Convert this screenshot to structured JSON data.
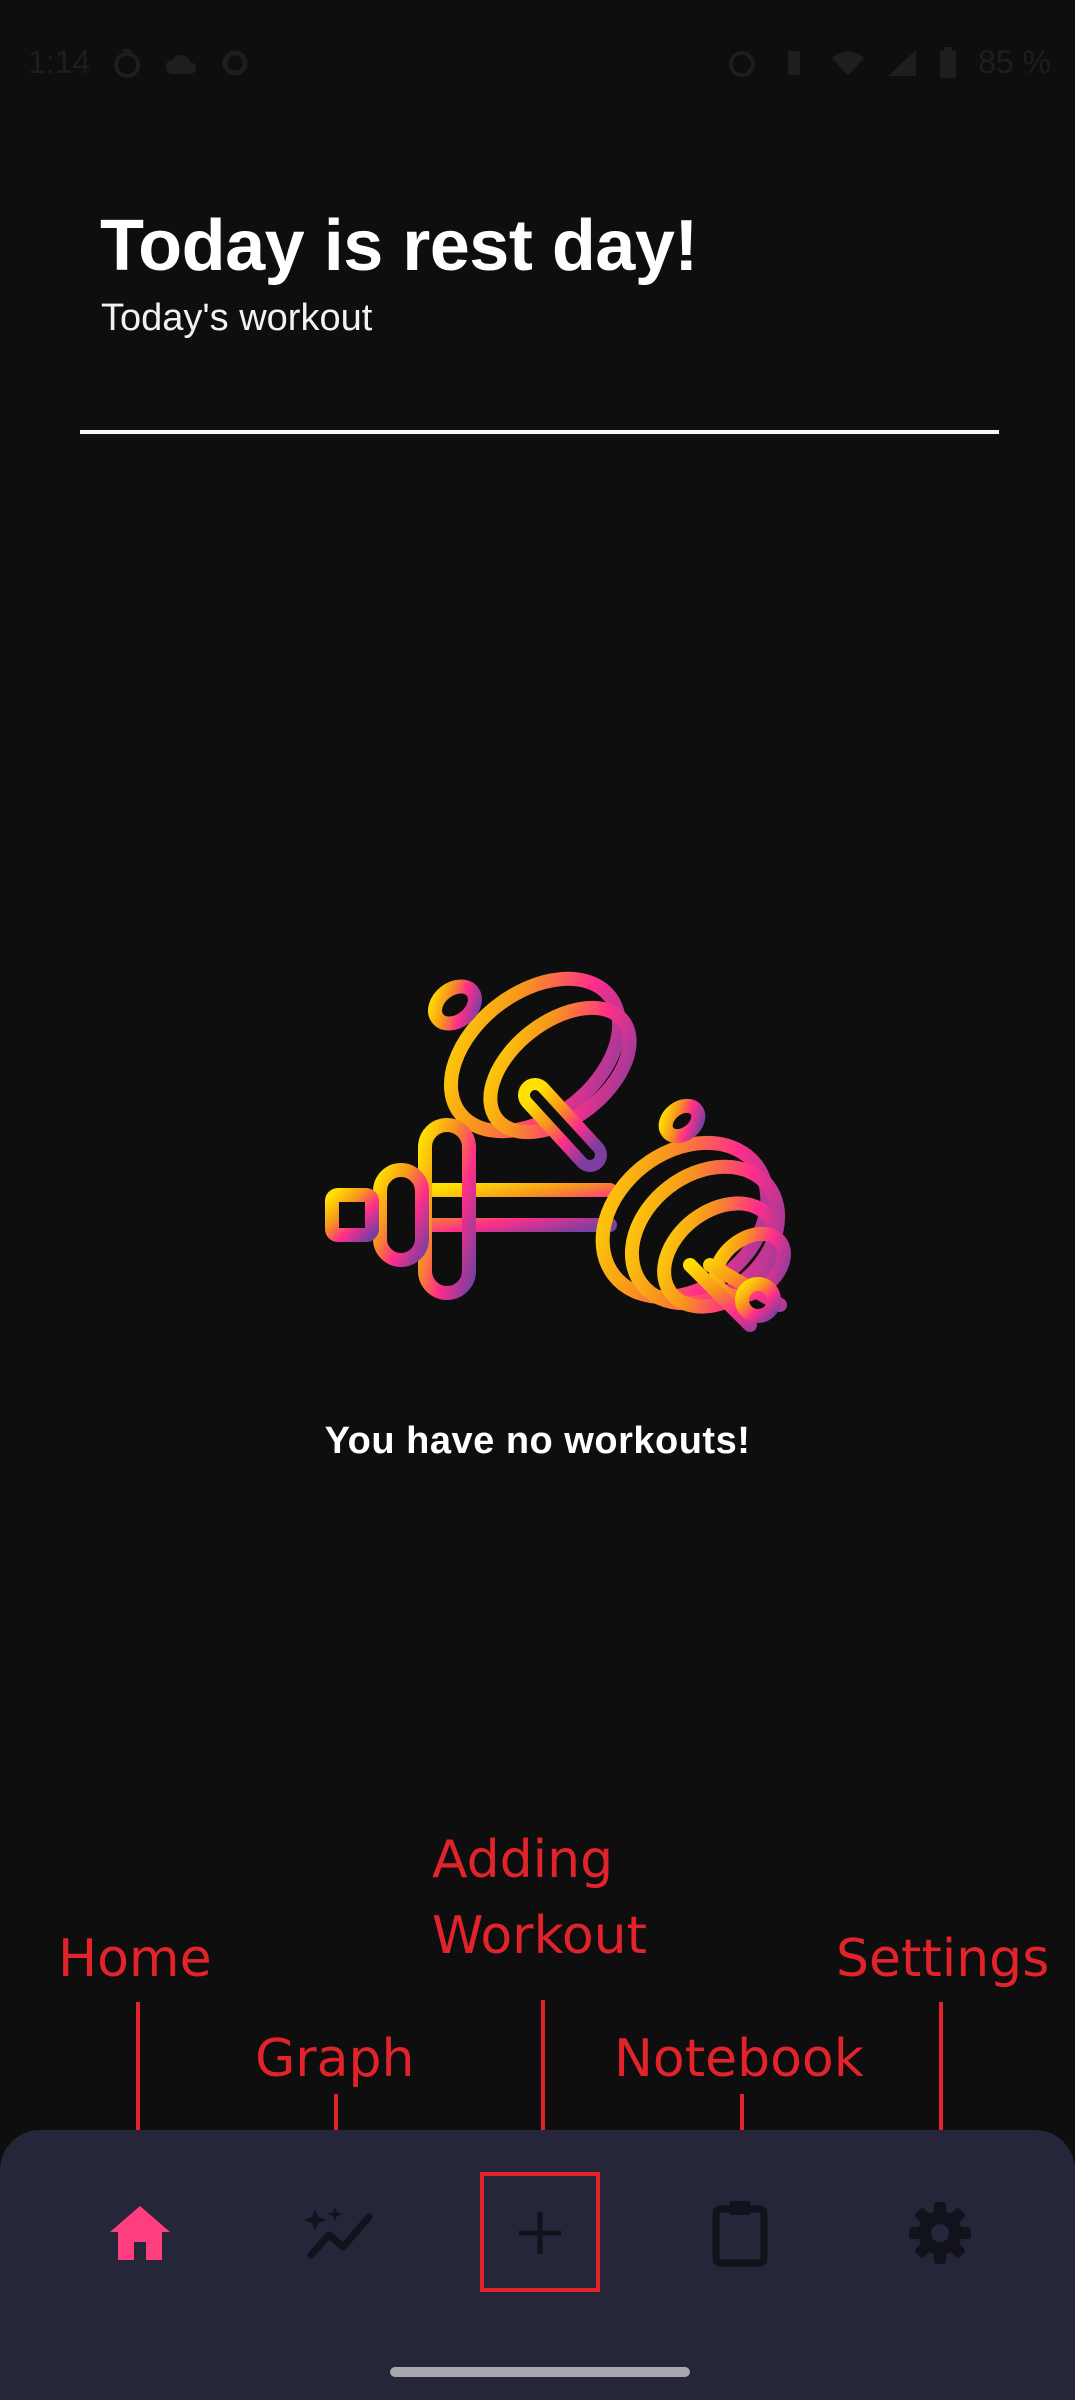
{
  "status_bar": {
    "time": "1:14",
    "battery": "85 %",
    "icons": [
      "timer-icon",
      "cloud-icon",
      "circle-icon",
      "alarm-icon",
      "vibrate-icon",
      "wifi-icon",
      "signal-icon",
      "battery-icon"
    ]
  },
  "header": {
    "title": "Today is rest day!",
    "subtitle": "Today's workout"
  },
  "empty_state": {
    "icon": "dumbbell-icon",
    "message": "You have no workouts!"
  },
  "annotations": {
    "home": "Home",
    "graph": "Graph",
    "adding_line1": "Adding",
    "adding_line2": "Workout",
    "notebook": "Notebook",
    "settings": "Settings"
  },
  "bottom_nav": {
    "items": [
      {
        "icon": "home-icon",
        "active": true
      },
      {
        "icon": "graph-icon",
        "active": false
      },
      {
        "icon": "plus-icon",
        "active": false
      },
      {
        "icon": "clipboard-icon",
        "active": false
      },
      {
        "icon": "gear-icon",
        "active": false
      }
    ],
    "active_color": "#ff3d7f",
    "inactive_color": "#11121b"
  },
  "colors": {
    "background": "#0e0e0f",
    "nav_background": "#25263a",
    "annotation_red": "#e2232a",
    "gradient": [
      "#ffe000",
      "#f7931e",
      "#ff2e8a",
      "#e91e8c",
      "#7b3fa0"
    ]
  }
}
